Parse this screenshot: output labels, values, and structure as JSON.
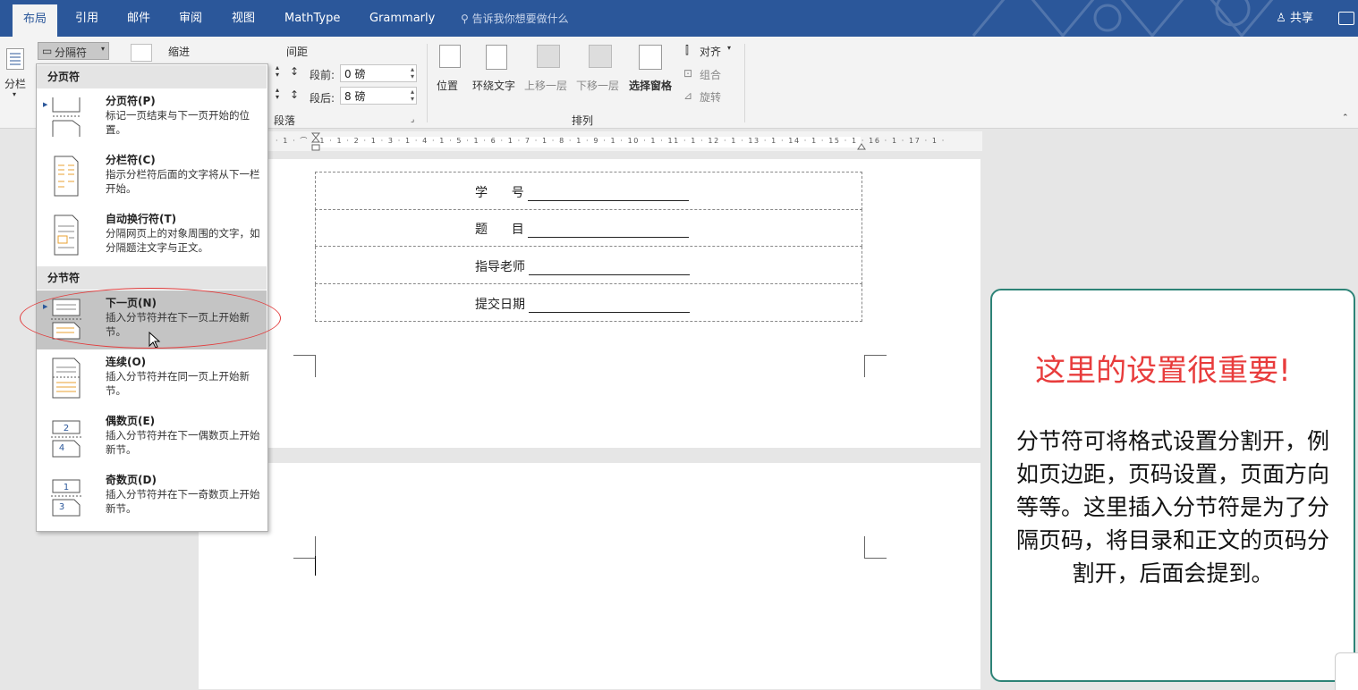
{
  "tabs": {
    "layout": "布局",
    "references": "引用",
    "mailings": "邮件",
    "review": "审阅",
    "view": "视图",
    "mathtype": "MathType",
    "grammarly": "Grammarly",
    "tell_me": "告诉我你想要做什么",
    "share": "共享"
  },
  "ribbon": {
    "columns_label": "分栏",
    "breaks_label": "分隔符",
    "indent_label": "缩进",
    "spacing_label": "间距",
    "before_label": "段前:",
    "before_value": "0 磅",
    "after_label": "段后:",
    "after_value": "8 磅",
    "paragraph_group": "段落",
    "position": "位置",
    "wrap_text": "环绕文字",
    "bring_forward": "上移一层",
    "send_backward": "下移一层",
    "selection_pane": "选择窗格",
    "align": "对齐",
    "group": "组合",
    "rotate": "旋转",
    "arrange_group": "排列"
  },
  "ruler": {
    "ticks": "· 1 · ⌒ · 1 · 1 · 2 · 1 · 3 · 1 · 4 · 1 · 5 · 1 · 6 · 1 · 7 · 1 · 8 · 1 · 9 · 1 · 10 · 1 · 11 · 1 · 12 · 1 · 13 · 1 · 14 · 1 · 15 · 1 · 16 · 1 · 17 · 1 ·"
  },
  "document": {
    "rows": [
      "学      号",
      "题      目",
      "指导老师",
      "提交日期"
    ]
  },
  "menu": {
    "page_breaks_header": "分页符",
    "section_breaks_header": "分节符",
    "items": [
      {
        "title": "分页符(P)",
        "desc": "标记一页结束与下一页开始的位置。"
      },
      {
        "title": "分栏符(C)",
        "desc": "指示分栏符后面的文字将从下一栏开始。"
      },
      {
        "title": "自动换行符(T)",
        "desc": "分隔网页上的对象周围的文字，如分隔题注文字与正文。"
      },
      {
        "title": "下一页(N)",
        "desc": "插入分节符并在下一页上开始新节。"
      },
      {
        "title": "连续(O)",
        "desc": "插入分节符并在同一页上开始新节。"
      },
      {
        "title": "偶数页(E)",
        "desc": "插入分节符并在下一偶数页上开始新节。"
      },
      {
        "title": "奇数页(D)",
        "desc": "插入分节符并在下一奇数页上开始新节。"
      }
    ]
  },
  "callout": {
    "heading": "这里的设置很重要!",
    "body": "分节符可将格式设置分割开，例如页边距，页码设置，页面方向等等。这里插入分节符是为了分隔页码，将目录和正文的页码分割开，后面会提到。"
  },
  "colors": {
    "ribbon_blue": "#2b579a",
    "callout_border": "#2d8377",
    "callout_heading": "#e83c3c",
    "highlight_oval": "#e23c3c"
  }
}
